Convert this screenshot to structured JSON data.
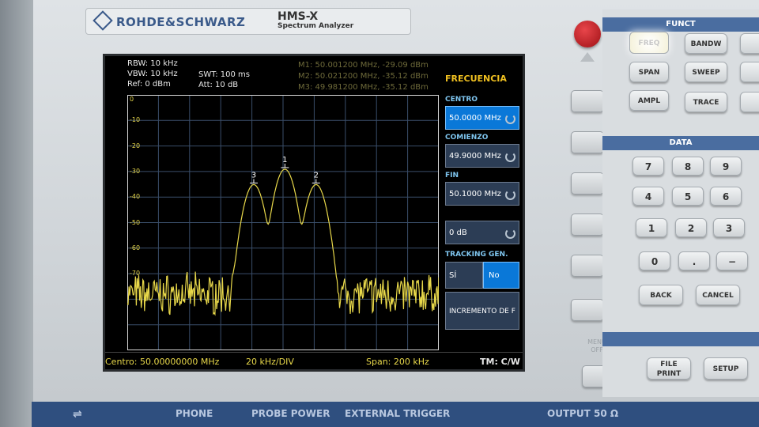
{
  "device": {
    "brand": "ROHDE&SCHWARZ",
    "model": "HMS-X",
    "subtitle": "Spectrum Analyzer"
  },
  "screen": {
    "params": {
      "rbw": "RBW: 10 kHz",
      "vbw": "VBW: 10 kHz",
      "ref": "Ref: 0 dBm",
      "swt": "SWT: 100 ms",
      "att": "Att: 10 dB"
    },
    "markers": [
      {
        "label": "M1: 50.001200 MHz, -29.09 dBm",
        "id": "1",
        "freq_mhz": 50.0012,
        "level_dbm": -29.09
      },
      {
        "label": "M2: 50.021200 MHz, -35.12 dBm",
        "id": "2",
        "freq_mhz": 50.0212,
        "level_dbm": -35.12
      },
      {
        "label": "M3: 49.981200 MHz, -35.12 dBm",
        "id": "3",
        "freq_mhz": 49.9812,
        "level_dbm": -35.12
      }
    ],
    "y_axis_labels": [
      "0",
      "-10",
      "-20",
      "-30",
      "-40",
      "-50",
      "-60",
      "-70"
    ],
    "footer": {
      "center": "Centro: 50.00000000 MHz",
      "div": "20 kHz/DIV",
      "span": "Span: 200 kHz",
      "tm": "TM: C/W"
    },
    "menu": {
      "title": "FRECUENCIA",
      "center_label": "CENTRO",
      "center_value": "50.0000 MHz",
      "start_label": "COMIENZO",
      "start_value": "49.9000 MHz",
      "stop_label": "FIN",
      "stop_value": "50.1000 MHz",
      "offset_value": "0 dB",
      "tracking_label": "TRACKING GEN.",
      "tracking_yes": "SÍ",
      "tracking_no": "No",
      "increment_label": "INCREMENTO DE F"
    },
    "trace_color": "#e8d84a"
  },
  "menu_off": "MENU OFF",
  "panel": {
    "function_head": "FUNCT",
    "data_head": "DATA",
    "keys": {
      "freq": "FREQ",
      "bandw": "BANDW",
      "span": "SPAN",
      "sweep": "SWEEP",
      "ampl": "AMPL",
      "trace": "TRACE",
      "n7": "7",
      "n8": "8",
      "n9": "9",
      "n4": "4",
      "n5": "5",
      "n6": "6",
      "n1": "1",
      "n2": "2",
      "n3": "3",
      "n0": "0",
      "dot": ".",
      "minus": "−",
      "back": "BACK",
      "cancel": "CANCEL",
      "file_print": "FILE PRINT",
      "setup": "SETUP"
    }
  },
  "bottom_strip": {
    "phone": "PHONE",
    "probe_power": "PROBE POWER",
    "external_trigger": "EXTERNAL TRIGGER",
    "output": "OUTPUT 50 Ω"
  }
}
